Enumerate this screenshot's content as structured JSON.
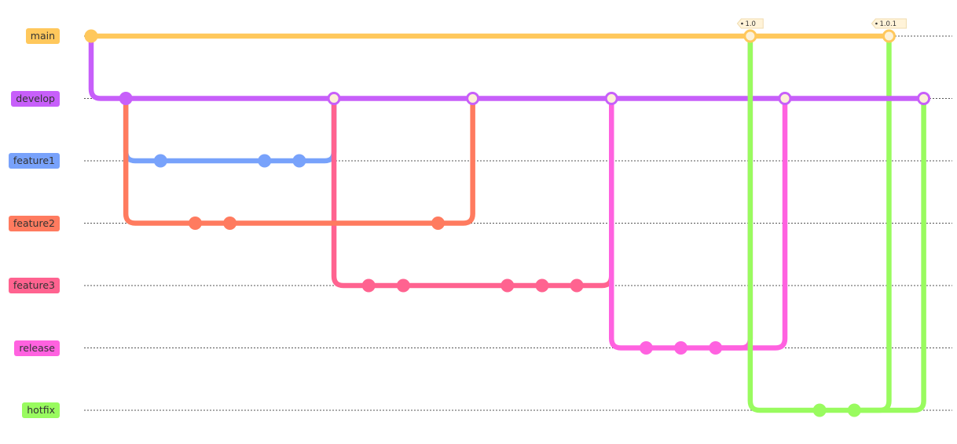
{
  "diagram": {
    "type": "git-graph",
    "merge_commit_fill": "#fdf1d8",
    "tag_fill": "#fff3d9",
    "tag_stroke": "#f0dcb0",
    "branches": [
      {
        "name": "main",
        "color": "#ffc85c"
      },
      {
        "name": "develop",
        "color": "#c75ffa"
      },
      {
        "name": "feature1",
        "color": "#78a2fb"
      },
      {
        "name": "feature2",
        "color": "#ff7b5f"
      },
      {
        "name": "feature3",
        "color": "#ff6390"
      },
      {
        "name": "release",
        "color": "#ff62e0"
      },
      {
        "name": "hotfix",
        "color": "#99fb5f"
      }
    ],
    "tags": [
      {
        "label": "1.0",
        "branch": "main",
        "commit_index": 14
      },
      {
        "label": "1.0.1",
        "branch": "main",
        "commit_index": 19
      }
    ],
    "commits_in_order": [
      {
        "branch": "main",
        "type": "normal"
      },
      {
        "branch": "develop",
        "type": "normal"
      },
      {
        "branch": "feature1",
        "type": "normal"
      },
      {
        "branch": "feature2",
        "type": "normal"
      },
      {
        "branch": "feature2",
        "type": "normal"
      },
      {
        "branch": "feature1",
        "type": "normal"
      },
      {
        "branch": "feature1",
        "type": "normal"
      },
      {
        "branch": "develop",
        "type": "merge",
        "from": "feature1"
      },
      {
        "branch": "feature3",
        "type": "normal"
      },
      {
        "branch": "feature3",
        "type": "normal"
      },
      {
        "branch": "feature2",
        "type": "normal"
      },
      {
        "branch": "develop",
        "type": "merge",
        "from": "feature2"
      },
      {
        "branch": "feature3",
        "type": "normal"
      },
      {
        "branch": "feature3",
        "type": "normal"
      },
      {
        "branch": "feature3",
        "type": "normal"
      },
      {
        "branch": "develop",
        "type": "merge",
        "from": "feature3"
      },
      {
        "branch": "release",
        "type": "normal"
      },
      {
        "branch": "release",
        "type": "normal"
      },
      {
        "branch": "release",
        "type": "normal"
      },
      {
        "branch": "main",
        "type": "merge",
        "from": "release",
        "tag": "1.0"
      },
      {
        "branch": "develop",
        "type": "merge",
        "from": "release"
      },
      {
        "branch": "hotfix",
        "type": "normal"
      },
      {
        "branch": "hotfix",
        "type": "normal"
      },
      {
        "branch": "main",
        "type": "merge",
        "from": "hotfix",
        "tag": "1.0.1"
      },
      {
        "branch": "develop",
        "type": "merge",
        "from": "hotfix"
      }
    ]
  }
}
